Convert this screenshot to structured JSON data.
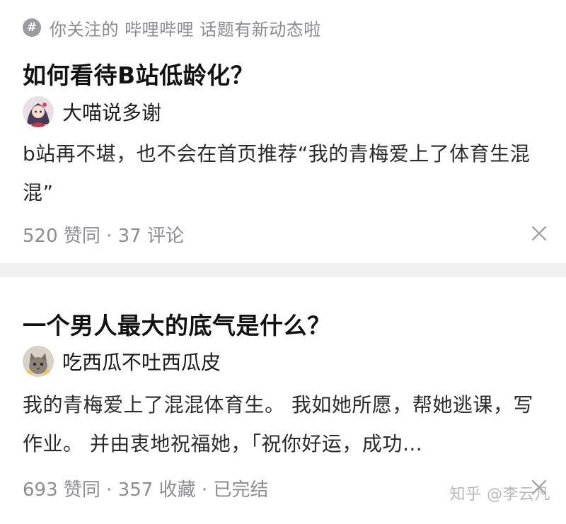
{
  "feed": {
    "cards": [
      {
        "topic": {
          "icon": "hash-icon",
          "text": "你关注的 哔哩哔哩 话题有新动态啦"
        },
        "title": "如何看待B站低龄化？",
        "author": {
          "name": "大喵说多谢",
          "avatar": "avatar-anime-girl"
        },
        "excerpt": "b站再不堪，也不会在首页推荐“我的青梅爱上了体育生混混”",
        "meta": "520 赞同 · 37 评论"
      },
      {
        "title": "一个男人最大的底气是什么？",
        "author": {
          "name": "吃西瓜不吐西瓜皮",
          "avatar": "avatar-cat"
        },
        "excerpt": "我的青梅爱上了混混体育生。 我如她所愿，帮她逃课，写作业。 并由衷地祝福她，「祝你好运，成功…",
        "meta": "693 赞同 · 357 收藏 · 已完结"
      }
    ]
  },
  "watermark": "知乎 @李云凡",
  "colors": {
    "separator": "#f1f1f3",
    "meta_text": "#8c8c92",
    "title_text": "#121212"
  }
}
